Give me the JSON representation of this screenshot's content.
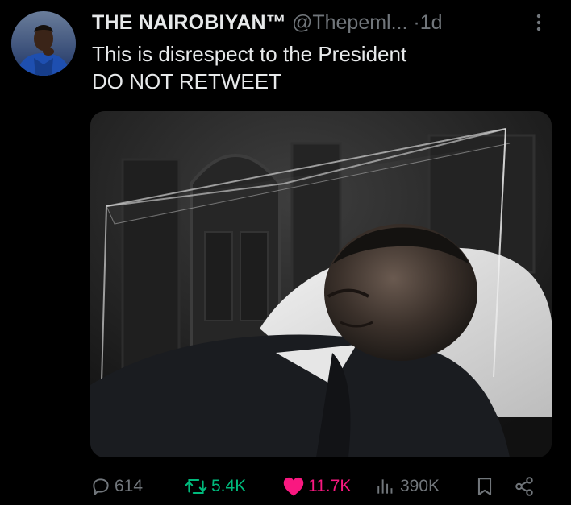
{
  "author": {
    "display_name": "THE NAIROBIYAN™",
    "handle": "@Thepeml...",
    "separator": "·",
    "time": "1d"
  },
  "post": {
    "lines": [
      "This is disrespect to the President",
      "DO NOT RETWEET"
    ]
  },
  "metrics": {
    "replies": "614",
    "retweets": "5.4K",
    "likes": "11.7K",
    "views": "390K"
  },
  "icons": {
    "avatar": "profile-photo",
    "more": "more-vertical-icon",
    "reply": "comment-icon",
    "retweet": "retweet-icon",
    "like": "heart-icon",
    "views": "analytics-icon",
    "bookmark": "bookmark-icon",
    "share": "share-icon"
  },
  "colors": {
    "background": "#000000",
    "text": "#e7e9ea",
    "muted": "#71767b",
    "retweet": "#00ba7c",
    "like": "#f91880"
  }
}
